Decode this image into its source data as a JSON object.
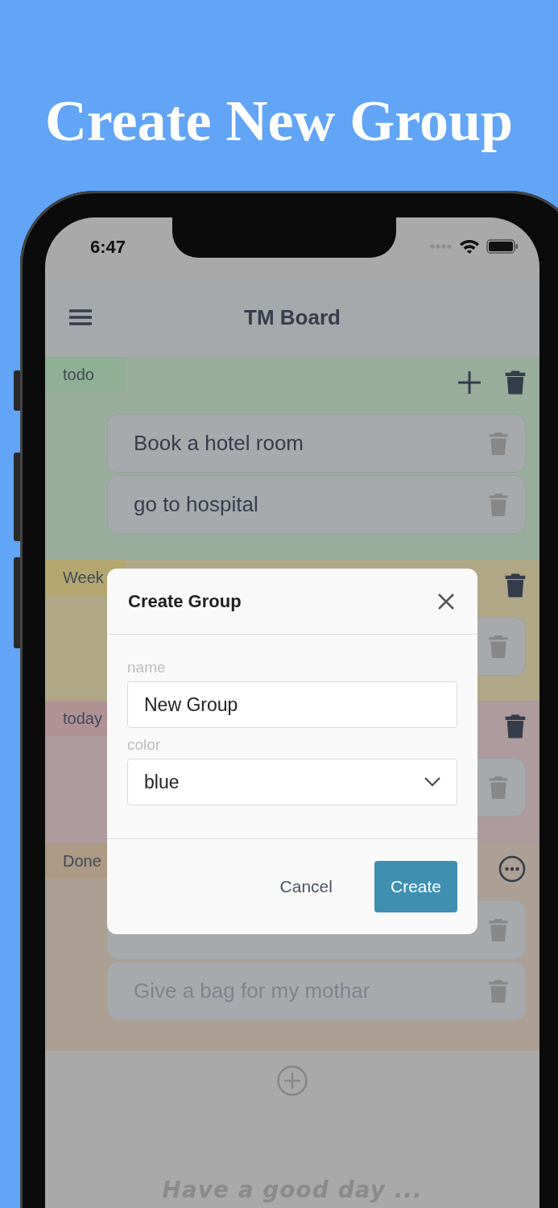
{
  "headline": "Create New Group",
  "status_bar": {
    "time": "6:47"
  },
  "app_bar": {
    "title": "TM Board"
  },
  "groups": [
    {
      "name": "todo",
      "color": "#8fb094",
      "actions": [
        {
          "kind": "add"
        },
        {
          "kind": "delete"
        }
      ],
      "tasks": [
        {
          "text": "Book a hotel room",
          "done": false
        },
        {
          "text": "go to hospital",
          "done": false
        }
      ]
    },
    {
      "name": "Week",
      "color": "#b3a66f",
      "actions": [
        {
          "kind": "delete"
        }
      ],
      "tasks": [
        {
          "done": false
        }
      ]
    },
    {
      "name": "today",
      "color": "#b09295",
      "actions": [
        {
          "kind": "delete"
        }
      ],
      "tasks": [
        {
          "done": false
        }
      ]
    },
    {
      "name": "Done",
      "color": "#ac9a85",
      "actions": [
        {
          "kind": "more"
        }
      ],
      "tasks": [
        {
          "done": true
        },
        {
          "text": "Give a bag for my mothar",
          "done": true
        }
      ]
    }
  ],
  "footer": {
    "tagline": "Have a good day ..."
  },
  "dialog": {
    "title": "Create Group",
    "fields": [
      {
        "kind": "text",
        "label": "name",
        "value": "New Group"
      },
      {
        "kind": "select",
        "label": "color",
        "value": "blue"
      }
    ],
    "buttons": [
      {
        "label": "Cancel",
        "kind": "secondary"
      },
      {
        "label": "Create",
        "kind": "primary"
      }
    ]
  }
}
